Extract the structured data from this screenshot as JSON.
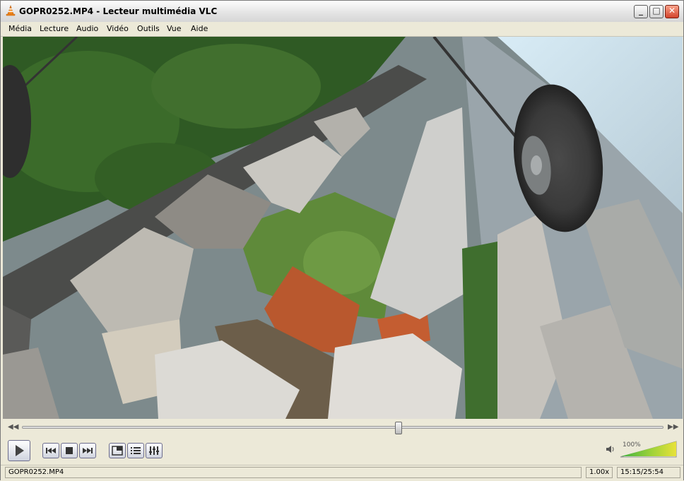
{
  "window": {
    "title": "GOPR0252.MP4 - Lecteur multimédia VLC",
    "minimize_label": "_",
    "maximize_label": "□",
    "close_label": "✕"
  },
  "menu": {
    "items": [
      "Média",
      "Lecture",
      "Audio",
      "Vidéo",
      "Outils",
      "Vue",
      "Aide"
    ]
  },
  "seek": {
    "position_fraction": 0.587
  },
  "controls": {
    "play_icon": "play-icon",
    "prev_icon": "previous-icon",
    "stop_icon": "stop-icon",
    "next_icon": "next-icon",
    "fullscreen_icon": "fullscreen-icon",
    "playlist_icon": "playlist-icon",
    "extended_icon": "extended-settings-icon"
  },
  "volume": {
    "percent_label": "100%",
    "level_fraction": 1.0
  },
  "status": {
    "filename": "GOPR0252.MP4",
    "speed": "1.00x",
    "time": "15:15/25:54"
  },
  "colors": {
    "vlc_orange": "#f68b1f",
    "volume_green": "#3fb23f",
    "volume_yellow": "#e8e23a"
  }
}
